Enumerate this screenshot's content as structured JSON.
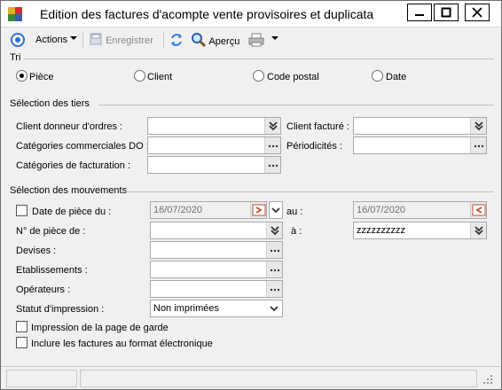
{
  "window": {
    "title": "Edition des factures d'acompte vente provisoires et duplicata"
  },
  "toolbar": {
    "actions_label": "Actions",
    "save_label": "Enregistrer",
    "preview_label": "Aperçu"
  },
  "tri": {
    "label": "Tri",
    "options": [
      "Pièce",
      "Client",
      "Code postal",
      "Date"
    ],
    "selected": "Pièce"
  },
  "tiers": {
    "label": "Sélection des tiers",
    "client_donneur_label": "Client donneur d'ordres :",
    "client_donneur_value": "",
    "client_facture_label": "Client facturé :",
    "client_facture_value": "",
    "categories_do_label": "Catégories commerciales DO :",
    "periodicites_label": "Périodicités :",
    "categories_facturation_label": "Catégories de facturation :"
  },
  "mouvements": {
    "label": "Sélection des mouvements",
    "date_piece_label": "Date de pièce du :",
    "date_from": "16/07/2020",
    "au_label": "au :",
    "date_to": "16/07/2020",
    "num_piece_label": "N° de pièce de :",
    "num_piece_from": "",
    "a_label": "à :",
    "num_piece_to": "zzzzzzzzzz",
    "devises_label": "Devises :",
    "etablissements_label": "Etablissements :",
    "operateurs_label": "Opérateurs :",
    "statut_label": "Statut d'impression :",
    "statut_value": "Non imprimées",
    "page_garde_label": "Impression de la page de garde",
    "format_electronique_label": "Inclure les factures au format électronique"
  }
}
